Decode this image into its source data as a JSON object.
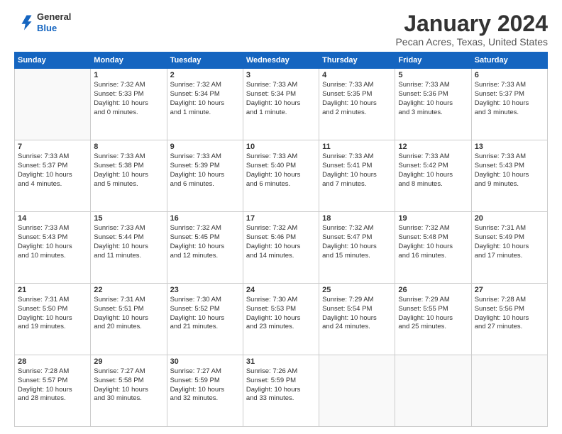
{
  "brand": {
    "name_general": "General",
    "name_blue": "Blue"
  },
  "title": "January 2024",
  "subtitle": "Pecan Acres, Texas, United States",
  "days_of_week": [
    "Sunday",
    "Monday",
    "Tuesday",
    "Wednesday",
    "Thursday",
    "Friday",
    "Saturday"
  ],
  "weeks": [
    [
      {
        "day": "",
        "content": ""
      },
      {
        "day": "1",
        "content": "Sunrise: 7:32 AM\nSunset: 5:33 PM\nDaylight: 10 hours\nand 0 minutes."
      },
      {
        "day": "2",
        "content": "Sunrise: 7:32 AM\nSunset: 5:34 PM\nDaylight: 10 hours\nand 1 minute."
      },
      {
        "day": "3",
        "content": "Sunrise: 7:33 AM\nSunset: 5:34 PM\nDaylight: 10 hours\nand 1 minute."
      },
      {
        "day": "4",
        "content": "Sunrise: 7:33 AM\nSunset: 5:35 PM\nDaylight: 10 hours\nand 2 minutes."
      },
      {
        "day": "5",
        "content": "Sunrise: 7:33 AM\nSunset: 5:36 PM\nDaylight: 10 hours\nand 3 minutes."
      },
      {
        "day": "6",
        "content": "Sunrise: 7:33 AM\nSunset: 5:37 PM\nDaylight: 10 hours\nand 3 minutes."
      }
    ],
    [
      {
        "day": "7",
        "content": "Sunrise: 7:33 AM\nSunset: 5:37 PM\nDaylight: 10 hours\nand 4 minutes."
      },
      {
        "day": "8",
        "content": "Sunrise: 7:33 AM\nSunset: 5:38 PM\nDaylight: 10 hours\nand 5 minutes."
      },
      {
        "day": "9",
        "content": "Sunrise: 7:33 AM\nSunset: 5:39 PM\nDaylight: 10 hours\nand 6 minutes."
      },
      {
        "day": "10",
        "content": "Sunrise: 7:33 AM\nSunset: 5:40 PM\nDaylight: 10 hours\nand 6 minutes."
      },
      {
        "day": "11",
        "content": "Sunrise: 7:33 AM\nSunset: 5:41 PM\nDaylight: 10 hours\nand 7 minutes."
      },
      {
        "day": "12",
        "content": "Sunrise: 7:33 AM\nSunset: 5:42 PM\nDaylight: 10 hours\nand 8 minutes."
      },
      {
        "day": "13",
        "content": "Sunrise: 7:33 AM\nSunset: 5:43 PM\nDaylight: 10 hours\nand 9 minutes."
      }
    ],
    [
      {
        "day": "14",
        "content": "Sunrise: 7:33 AM\nSunset: 5:43 PM\nDaylight: 10 hours\nand 10 minutes."
      },
      {
        "day": "15",
        "content": "Sunrise: 7:33 AM\nSunset: 5:44 PM\nDaylight: 10 hours\nand 11 minutes."
      },
      {
        "day": "16",
        "content": "Sunrise: 7:32 AM\nSunset: 5:45 PM\nDaylight: 10 hours\nand 12 minutes."
      },
      {
        "day": "17",
        "content": "Sunrise: 7:32 AM\nSunset: 5:46 PM\nDaylight: 10 hours\nand 14 minutes."
      },
      {
        "day": "18",
        "content": "Sunrise: 7:32 AM\nSunset: 5:47 PM\nDaylight: 10 hours\nand 15 minutes."
      },
      {
        "day": "19",
        "content": "Sunrise: 7:32 AM\nSunset: 5:48 PM\nDaylight: 10 hours\nand 16 minutes."
      },
      {
        "day": "20",
        "content": "Sunrise: 7:31 AM\nSunset: 5:49 PM\nDaylight: 10 hours\nand 17 minutes."
      }
    ],
    [
      {
        "day": "21",
        "content": "Sunrise: 7:31 AM\nSunset: 5:50 PM\nDaylight: 10 hours\nand 19 minutes."
      },
      {
        "day": "22",
        "content": "Sunrise: 7:31 AM\nSunset: 5:51 PM\nDaylight: 10 hours\nand 20 minutes."
      },
      {
        "day": "23",
        "content": "Sunrise: 7:30 AM\nSunset: 5:52 PM\nDaylight: 10 hours\nand 21 minutes."
      },
      {
        "day": "24",
        "content": "Sunrise: 7:30 AM\nSunset: 5:53 PM\nDaylight: 10 hours\nand 23 minutes."
      },
      {
        "day": "25",
        "content": "Sunrise: 7:29 AM\nSunset: 5:54 PM\nDaylight: 10 hours\nand 24 minutes."
      },
      {
        "day": "26",
        "content": "Sunrise: 7:29 AM\nSunset: 5:55 PM\nDaylight: 10 hours\nand 25 minutes."
      },
      {
        "day": "27",
        "content": "Sunrise: 7:28 AM\nSunset: 5:56 PM\nDaylight: 10 hours\nand 27 minutes."
      }
    ],
    [
      {
        "day": "28",
        "content": "Sunrise: 7:28 AM\nSunset: 5:57 PM\nDaylight: 10 hours\nand 28 minutes."
      },
      {
        "day": "29",
        "content": "Sunrise: 7:27 AM\nSunset: 5:58 PM\nDaylight: 10 hours\nand 30 minutes."
      },
      {
        "day": "30",
        "content": "Sunrise: 7:27 AM\nSunset: 5:59 PM\nDaylight: 10 hours\nand 32 minutes."
      },
      {
        "day": "31",
        "content": "Sunrise: 7:26 AM\nSunset: 5:59 PM\nDaylight: 10 hours\nand 33 minutes."
      },
      {
        "day": "",
        "content": ""
      },
      {
        "day": "",
        "content": ""
      },
      {
        "day": "",
        "content": ""
      }
    ]
  ]
}
